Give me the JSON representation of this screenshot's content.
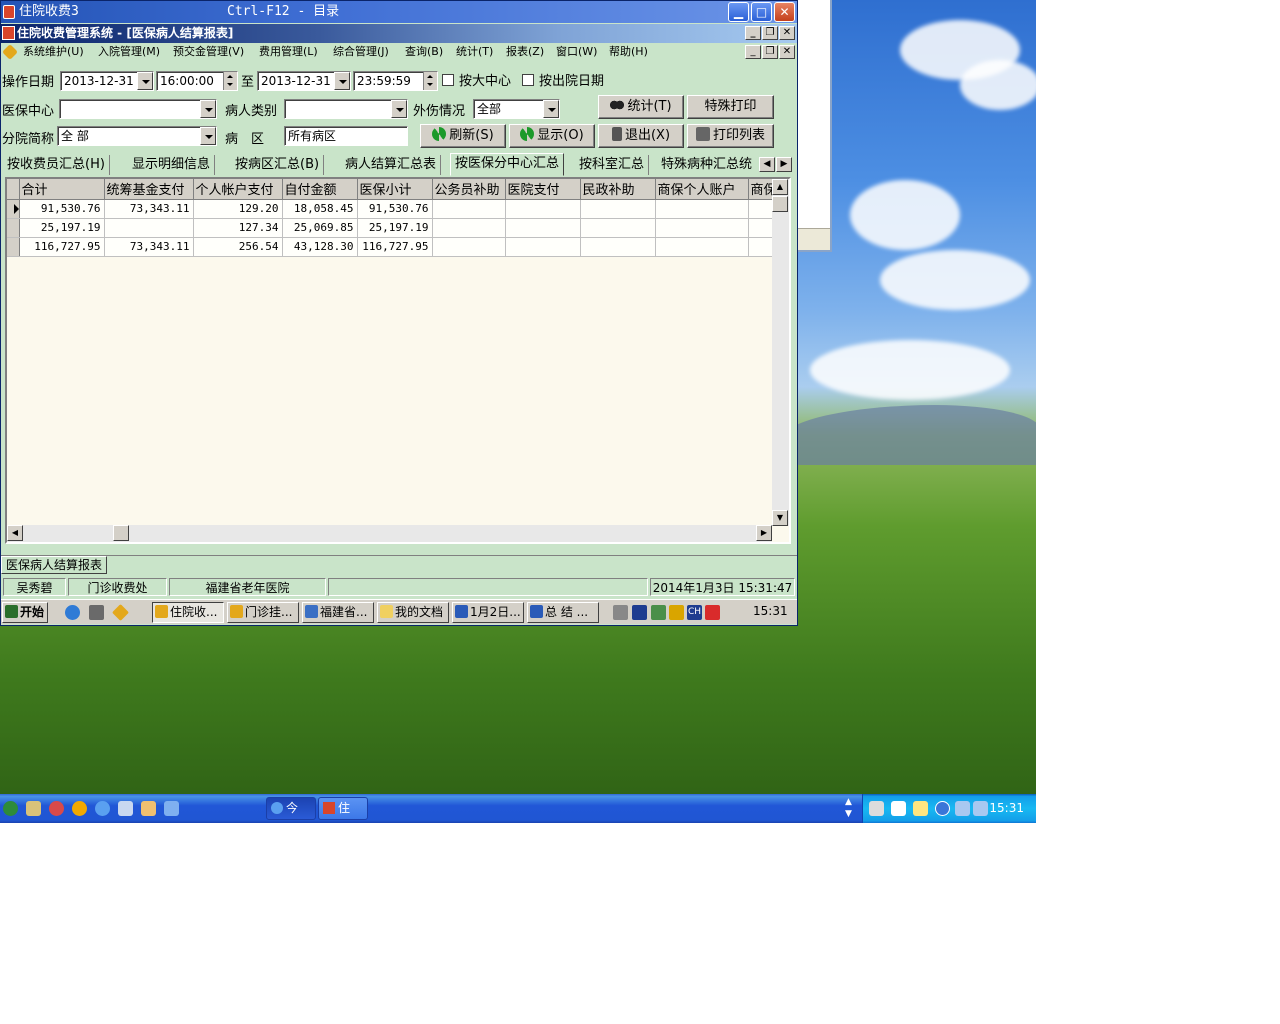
{
  "desktop": {
    "back_window": {}
  },
  "window": {
    "title": "住院收费3",
    "shortcut_hint": "Ctrl-F12 - 目录",
    "inner_title": "住院收费管理系统 - [医保病人结算报表]"
  },
  "menu": [
    "系统维护(U)",
    "入院管理(M)",
    "预交金管理(V)",
    "费用管理(L)",
    "综合管理(J)",
    "查询(B)",
    "统计(T)",
    "报表(Z)",
    "窗口(W)",
    "帮助(H)"
  ],
  "filters": {
    "op_date_label": "操作日期",
    "date_from": "2013-12-31",
    "time_from": "16:00:00",
    "to_label": "至",
    "date_to": "2013-12-31",
    "time_to": "23:59:59",
    "by_center_label": "按大中心",
    "by_discharge_label": "按出院日期",
    "insurance_center_label": "医保中心",
    "insurance_center_value": "",
    "patient_type_label": "病人类别",
    "patient_type_value": "",
    "injury_label": "外伤情况",
    "injury_value": "全部",
    "branch_label": "分院简称",
    "branch_value": "全 部",
    "ward_label": "病　区",
    "ward_value": "所有病区"
  },
  "buttons": {
    "stats": "统计(T)",
    "special_print": "特殊打印",
    "refresh": "刷新(S)",
    "display": "显示(O)",
    "exit": "退出(X)",
    "print_list": "打印列表"
  },
  "tabs": [
    "按收费员汇总(H)",
    "显示明细信息",
    "按病区汇总(B)",
    "病人结算汇总表",
    "按医保分中心汇总",
    "按科室汇总",
    "特殊病种汇总统"
  ],
  "active_tab_index": 4,
  "table": {
    "columns": [
      "合计",
      "统筹基金支付",
      "个人帐户支付",
      "自付金额",
      "医保小计",
      "公务员补助",
      "医院支付",
      "民政补助",
      "商保个人账户",
      "商保"
    ],
    "rows": [
      [
        "91,530.76",
        "73,343.11",
        "129.20",
        "18,058.45",
        "91,530.76",
        "",
        "",
        "",
        "",
        ""
      ],
      [
        "25,197.19",
        "",
        "127.34",
        "25,069.85",
        "25,197.19",
        "",
        "",
        "",
        "",
        ""
      ],
      [
        "116,727.95",
        "73,343.11",
        "256.54",
        "43,128.30",
        "116,727.95",
        "",
        "",
        "",
        "",
        ""
      ]
    ],
    "current_row": 0
  },
  "report_tab": "医保病人结算报表",
  "status": {
    "user": "吴秀碧",
    "department": "门诊收费处",
    "hospital": "福建省老年医院",
    "datetime": "2014年1月3日 15:31:47"
  },
  "inner_taskbar": {
    "start": "开始",
    "tasks": [
      "住院收...",
      "门诊挂...",
      "福建省...",
      "我的文档",
      "1月2日...",
      "总 结 ..."
    ],
    "clock": "15:31",
    "ime": "CH"
  },
  "xp_taskbar": {
    "tasks": [
      "今",
      "住"
    ],
    "clock": "15:31"
  },
  "colors": {
    "app_background": "#c9e4c9",
    "title_bar": "#2454b6",
    "xp_taskbar": "#2157d7",
    "grid_background": "#fcf9ed"
  }
}
